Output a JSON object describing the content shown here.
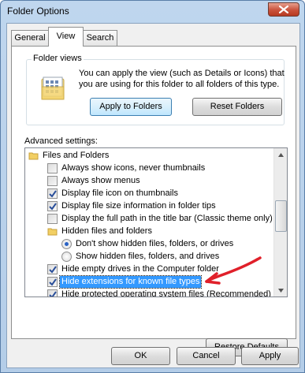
{
  "window": {
    "title": "Folder Options",
    "close_icon": "close-x-icon"
  },
  "tabs": [
    {
      "label": "General",
      "active": false
    },
    {
      "label": "View",
      "active": true
    },
    {
      "label": "Search",
      "active": false
    }
  ],
  "folder_views": {
    "group_label": "Folder views",
    "description": "You can apply the view (such as Details or Icons) that you are using for this folder to all folders of this type.",
    "icon": "folder-details-view-icon",
    "apply_button": "Apply to Folders",
    "reset_button": "Reset Folders"
  },
  "advanced": {
    "label": "Advanced settings:",
    "items": [
      {
        "type": "folder",
        "label": "Files and Folders"
      },
      {
        "type": "checkbox",
        "checked": false,
        "label": "Always show icons, never thumbnails"
      },
      {
        "type": "checkbox",
        "checked": false,
        "label": "Always show menus"
      },
      {
        "type": "checkbox",
        "checked": true,
        "label": "Display file icon on thumbnails"
      },
      {
        "type": "checkbox",
        "checked": true,
        "label": "Display file size information in folder tips"
      },
      {
        "type": "checkbox",
        "checked": false,
        "label": "Display the full path in the title bar (Classic theme only)"
      },
      {
        "type": "folder",
        "label": "Hidden files and folders"
      },
      {
        "type": "radio",
        "checked": true,
        "label": "Don't show hidden files, folders, or drives"
      },
      {
        "type": "radio",
        "checked": false,
        "label": "Show hidden files, folders, and drives"
      },
      {
        "type": "checkbox",
        "checked": true,
        "label": "Hide empty drives in the Computer folder"
      },
      {
        "type": "checkbox",
        "checked": true,
        "label": "Hide extensions for known file types",
        "selected": true
      },
      {
        "type": "checkbox",
        "checked": true,
        "label": "Hide protected operating system files (Recommended)"
      }
    ]
  },
  "restore_button": "Restore Defaults",
  "footer": {
    "ok": "OK",
    "cancel": "Cancel",
    "apply": "Apply"
  },
  "colors": {
    "selection": "#3399ff",
    "annotation_arrow": "#e0202a",
    "close_button": "#c9523b"
  }
}
